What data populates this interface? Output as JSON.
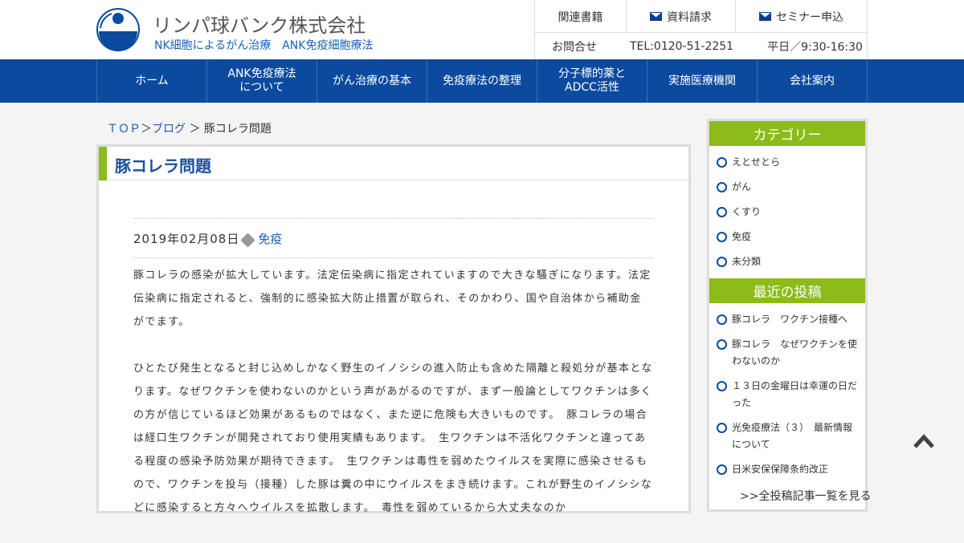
{
  "header": {
    "site_title": "リンパ球バンク株式会社",
    "site_subtitle": "NK細胞によるがん治療　ANK免疫細胞療法",
    "links": [
      "関連書籍",
      "資料請求",
      "セミナー申込"
    ],
    "contact_label": "お問合せ",
    "tel": "TEL:0120-51-2251",
    "hours": "平日／9:30-16:30"
  },
  "nav": {
    "items": [
      "ホーム",
      "ANK免疫療法\nについて",
      "がん治療の基本",
      "免疫療法の整理",
      "分子標的薬と\nADCC活性",
      "実施医療機関",
      "会社案内"
    ]
  },
  "breadcrumb": {
    "top": "ＴＯＰ",
    "sep1": "＞",
    "blog": "ブログ",
    "sep2": "＞",
    "current": "豚コレラ問題"
  },
  "post": {
    "title": "豚コレラ問題",
    "date": "2019年02月08日",
    "tag": "免疫",
    "paragraphs": [
      "豚コレラの感染が拡大しています。法定伝染病に指定されていますので大きな騒ぎになります。法定伝染病に指定されると、強制的に感染拡大防止措置が取られ、そのかわり、国や自治体から補助金がでます。",
      "ひとたび発生となると封じ込めしかなく野生のイノシシの進入防止も含めた隔離と殺処分が基本となります。なぜワクチンを使わないのかという声があがるのですが、まず一般論としてワクチンは多くの方が信じているほど効果があるものではなく、また逆に危険も大きいものです。　豚コレラの場合は経口生ワクチンが開発されており使用実績もあります。　生ワクチンは不活化ワクチンと違ってある程度の感染予防効果が期待できます。　生ワクチンは毒性を弱めたウイルスを実際に感染させるもので、ワクチンを投与（接種）した豚は糞の中にウイルスをまき続けます。これが野生のイノシシなどに感染すると方々へウイルスを拡散します。　毒性を弱めているから大丈夫なのか"
    ]
  },
  "sidebar": {
    "category_title": "カテゴリー",
    "categories": [
      "えとせとら",
      "がん",
      "くすり",
      "免疫",
      "未分類"
    ],
    "recent_title": "最近の投稿",
    "recent": [
      "豚コレラ　ワクチン接種へ",
      "豚コレラ　なぜワクチンを使わないのか",
      "１３日の金曜日は幸運の日だった",
      "光免疫療法（３）　最新情報について",
      "日米安保保障条約改正"
    ],
    "all_link": ">>全投稿記事一覧を見る"
  },
  "colors": {
    "nav_bg": "#0b4a9e",
    "accent_green": "#8dbb1a",
    "link_blue": "#1a5fb4"
  }
}
